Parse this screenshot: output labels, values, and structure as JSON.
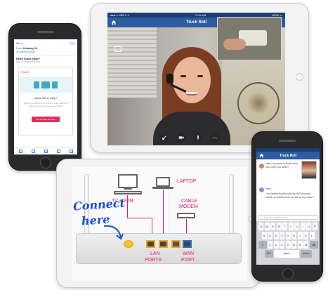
{
  "ipad_top": {
    "status_carrier": "●●●○○ BELL ᯤ",
    "status_time": "9:41 AM",
    "status_battery": "100% ▭",
    "title": "Truck Roll"
  },
  "iphone_left": {
    "back_label": "Inbox",
    "action_label": "Hide",
    "from_label": "From:",
    "from_value": "Kimberly W.",
    "to_label": "To:",
    "to_value": "Daniel Evans",
    "subject": "Need Some Help?",
    "date": "May 12, 2015 at 5:46 PM",
    "card_brand": "TELUS",
    "card_question": "Need Some Help?",
    "card_text": "MyBiz Now allows you to set up video calls and share your screen to get expert help.",
    "card_button": "Get a Quick Fix Now"
  },
  "ipad_bottom": {
    "label_tv": "TV + STB",
    "label_laptop": "LAPTOP",
    "label_cable_1": "CABLE",
    "label_cable_2": "MODEM",
    "label_lan_1": "LAN",
    "label_lan_2": "PORTS",
    "label_wan_1": "WAN",
    "label_wan_2": "PORT",
    "handwrite_1": "Connect",
    "handwrite_2": "here"
  },
  "iphone_right": {
    "title": "Truck Roll",
    "msg_1": "Hello, my name is Emily. How can I help you today?",
    "msg_2": "Hello",
    "msg_3": "I am having trouble with my WiFi at home. Could you please help me set up my router?",
    "input_placeholder": "Enter text regarding Chat",
    "keyboard_row_1": [
      "Q",
      "W",
      "E",
      "R",
      "T",
      "Y",
      "U",
      "I",
      "O",
      "P"
    ],
    "keyboard_row_2": [
      "A",
      "S",
      "D",
      "F",
      "G",
      "H",
      "J",
      "K",
      "L"
    ],
    "keyboard_row_3": [
      "Z",
      "X",
      "C",
      "V",
      "B",
      "N",
      "M"
    ],
    "key_numbers": "123",
    "key_space": "space",
    "key_return": "return"
  },
  "colors": {
    "nav_blue": "#2d5da0",
    "status_blue": "#1c3f73",
    "label_pink": "#e21d6b",
    "port_orange": "#f3a81b",
    "wan_blue": "#2e72d2",
    "handwriting_blue": "#1d4fd6"
  }
}
